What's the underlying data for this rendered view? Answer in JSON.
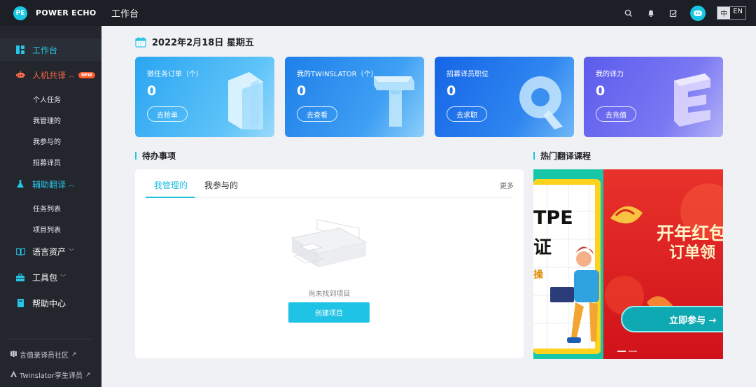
{
  "brand": {
    "logo_text": "PE",
    "name": "POWER ECHO"
  },
  "header": {
    "title": "工作台",
    "lang_zh": "中",
    "lang_en": "EN"
  },
  "sidebar": {
    "items": [
      {
        "label": "工作台",
        "icon": "dashboard-icon"
      },
      {
        "label": "人机共译",
        "icon": "robot-icon",
        "badge": "NEW"
      },
      {
        "label": "辅助翻译",
        "icon": "flask-icon"
      },
      {
        "label": "语言资产",
        "icon": "book-icon"
      },
      {
        "label": "工具包",
        "icon": "toolbox-icon"
      },
      {
        "label": "帮助中心",
        "icon": "help-book-icon"
      }
    ],
    "sub_rengong": [
      "个人任务",
      "我管理的",
      "我参与的",
      "招募译员"
    ],
    "sub_fuzhu": [
      "任务列表",
      "项目列表"
    ],
    "footer": [
      "言值录译员社区",
      "Twinslator孪生译员"
    ]
  },
  "date": "2022年2月18日 星期五",
  "cards": [
    {
      "title": "微任务订单（个）",
      "value": "0",
      "button": "去抢单",
      "letter": "I",
      "color": "#41b4f5"
    },
    {
      "title": "我的TWINSLATOR（个）",
      "value": "0",
      "button": "去查看",
      "letter": "T",
      "color": "#2f8ef2"
    },
    {
      "title": "招募译员职位",
      "value": "0",
      "button": "去求职",
      "letter": "Q",
      "color": "#2a78ee"
    },
    {
      "title": "我的译力",
      "value": "0",
      "button": "去充值",
      "letter": "E",
      "color": "#6f6ff2"
    }
  ],
  "todo": {
    "title": "待办事项",
    "tabs": [
      "我管理的",
      "我参与的"
    ],
    "more": "更多",
    "empty_text": "尚未找到项目",
    "create_button": "创建项目"
  },
  "courses": {
    "title": "热门翻译课程",
    "slide1_text": [
      "TPE",
      "证",
      "操"
    ],
    "slide2_text": [
      "开年红包",
      "订单领",
      "立即参与"
    ]
  }
}
